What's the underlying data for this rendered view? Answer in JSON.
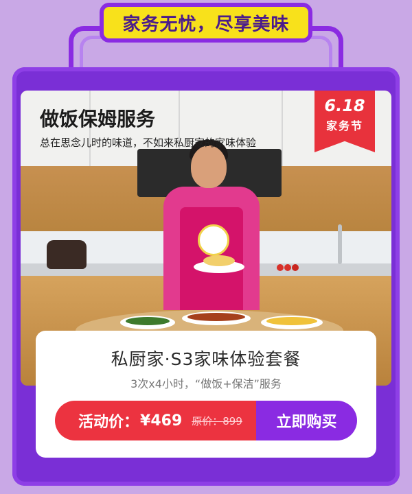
{
  "banner": {
    "slogan": "家务无忧，尽享美味"
  },
  "hero": {
    "title": "做饭保姆服务",
    "subtitle": "总在思念儿时的味道，不如来私厨家的家味体验"
  },
  "badge": {
    "number": "6.18",
    "label": "家务节"
  },
  "card": {
    "title": "私厨家·S3家味体验套餐",
    "subtitle": "3次x4小时，“做饭+保洁”服务",
    "price_label": "活动价：",
    "price_value": "¥469",
    "original_label": "原价：",
    "original_value": "899",
    "buy_label": "立即购买"
  },
  "colors": {
    "brand_purple": "#8a2be2",
    "slogan_yellow": "#f8e11b",
    "price_red": "#ec3340"
  }
}
